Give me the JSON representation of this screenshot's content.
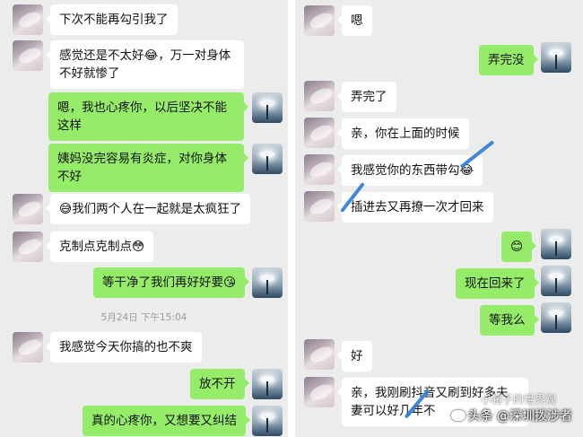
{
  "left_chat": {
    "messages": [
      {
        "side": "them",
        "text": "下次不能再勾引我了"
      },
      {
        "side": "them",
        "text": "感觉还是不太好😂，万一对身体不好就惨了"
      },
      {
        "side": "me",
        "text": "嗯，我也心疼你，以后坚决不能这样"
      },
      {
        "side": "me",
        "text": "姨妈没完容易有炎症，对你身体不好"
      },
      {
        "side": "them",
        "text": "😅我们两个人在一起就是太疯狂了"
      },
      {
        "side": "them",
        "text": "克制点克制点😳"
      },
      {
        "side": "me",
        "text": "等干净了我们再好好要😘"
      },
      {
        "side": "them",
        "text": "我感觉今天你搞的也不爽"
      },
      {
        "side": "me",
        "text": "放不开"
      },
      {
        "side": "me",
        "text": "真的心疼你，又想要又纠结"
      }
    ],
    "timestamp": "5月24日 下午15:04"
  },
  "right_chat": {
    "messages": [
      {
        "side": "them",
        "text": "嗯"
      },
      {
        "side": "me",
        "text": "弄完没"
      },
      {
        "side": "them",
        "text": "弄完了"
      },
      {
        "side": "them",
        "text": "亲，你在上面的时候"
      },
      {
        "side": "them",
        "text": "我感觉你的东西带勾😂"
      },
      {
        "side": "them",
        "text": "插进去又再撩一次才回来"
      },
      {
        "side": "me",
        "text": "😊"
      },
      {
        "side": "me",
        "text": "现在回来了"
      },
      {
        "side": "me",
        "text": "等我么"
      },
      {
        "side": "them",
        "text": "好"
      },
      {
        "side": "them",
        "text": "亲，我刚刷抖音又刷到好多夫妻可以好几年不"
      }
    ]
  },
  "watermark": {
    "text": "头条 @深圳拨涉者",
    "faint_text": "小猪子的世界观"
  },
  "colors": {
    "chat_bg": "#ececec",
    "bubble_me": "#95ec69",
    "bubble_them": "#ffffff",
    "timestamp": "#9a9a9a",
    "stroke": "#2f7fd9"
  }
}
